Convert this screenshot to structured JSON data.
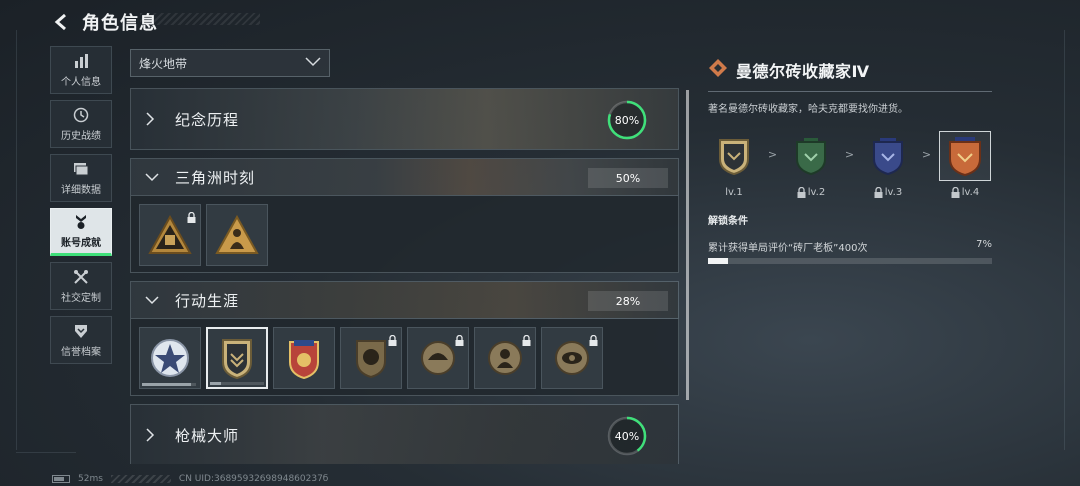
{
  "header": {
    "title": "角色信息"
  },
  "sidebar": {
    "items": [
      {
        "label": "个人信息",
        "icon": "bar-chart-icon",
        "active": false
      },
      {
        "label": "历史战绩",
        "icon": "history-icon",
        "active": false
      },
      {
        "label": "详细数据",
        "icon": "data-cards-icon",
        "active": false
      },
      {
        "label": "账号成就",
        "icon": "achievement-icon",
        "active": true
      },
      {
        "label": "社交定制",
        "icon": "tools-icon",
        "active": false
      },
      {
        "label": "信誉档案",
        "icon": "credit-shield-icon",
        "active": false
      }
    ]
  },
  "filter": {
    "selected": "烽火地带"
  },
  "sections": [
    {
      "title": "纪念历程",
      "progress_text": "80%",
      "progress": 0.8,
      "expanded": false
    },
    {
      "title": "三角洲时刻",
      "progress_text": "50%",
      "progress": 0.5,
      "expanded": true
    },
    {
      "title": "行动生涯",
      "progress_text": "28%",
      "progress": 0.28,
      "expanded": true
    },
    {
      "title": "枪械大师",
      "progress_text": "40%",
      "progress": 0.4,
      "expanded": false
    }
  ],
  "detail": {
    "title": "曼德尔砖收藏家Ⅳ",
    "description": "著名曼德尔砖收藏家，哈夫克都要找你进货。",
    "levels": [
      {
        "label": "lv.1",
        "locked": false
      },
      {
        "label": "lv.2",
        "locked": true
      },
      {
        "label": "lv.3",
        "locked": true
      },
      {
        "label": "lv.4",
        "locked": true
      }
    ],
    "unlock_title": "解锁条件",
    "condition": {
      "text": "累计获得单局评价“砖厂老板”400次",
      "value_text": "7%",
      "value": 0.07
    }
  },
  "footer": {
    "ping": "52ms",
    "uid": "CN UID:3689593269894860237б"
  },
  "colors": {
    "accent_green": "#3fe07a",
    "active_tab_bg": "#dfe5e8"
  }
}
